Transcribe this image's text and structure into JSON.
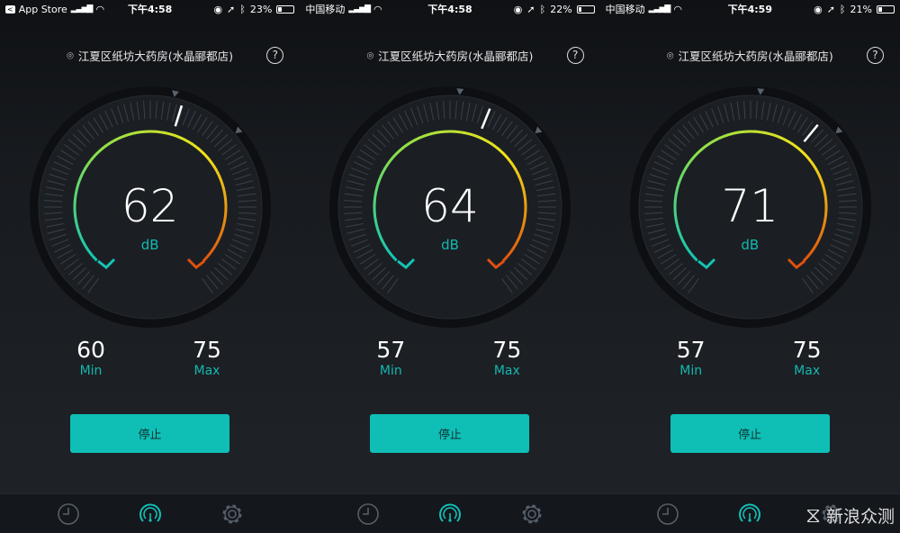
{
  "screens": [
    {
      "status": {
        "left": "App Store",
        "back": true,
        "time": "下午4:58",
        "battery": "23%",
        "battery_level": 0.23
      },
      "location": "江夏区纸坊大药房(水晶郦都店)",
      "value": "62",
      "unit": "dB",
      "min": "60",
      "max": "75",
      "min_label": "Min",
      "max_label": "Max",
      "button": "停止"
    },
    {
      "status": {
        "left": "中国移动",
        "back": false,
        "time": "下午4:58",
        "battery": "22%",
        "battery_level": 0.22
      },
      "location": "江夏区纸坊大药房(水晶郦都店)",
      "value": "64",
      "unit": "dB",
      "min": "57",
      "max": "75",
      "min_label": "Min",
      "max_label": "Max",
      "button": "停止"
    },
    {
      "status": {
        "left": "中国移动",
        "back": false,
        "time": "下午4:59",
        "battery": "21%",
        "battery_level": 0.21
      },
      "location": "江夏区纸坊大药房(水晶郦都店)",
      "value": "71",
      "unit": "dB",
      "min": "57",
      "max": "75",
      "min_label": "Min",
      "max_label": "Max",
      "button": "停止"
    }
  ],
  "tabs": [
    {
      "icon": "clock-icon"
    },
    {
      "icon": "gauge-icon",
      "active": true
    },
    {
      "icon": "gear-icon"
    }
  ],
  "watermark": "新浪众测",
  "colors": {
    "accent": "#0fbfb6",
    "arc_start": "#14c4b4",
    "arc_mid": "#8be04a",
    "arc_yellow": "#f2e21a",
    "arc_end": "#e0500e"
  }
}
